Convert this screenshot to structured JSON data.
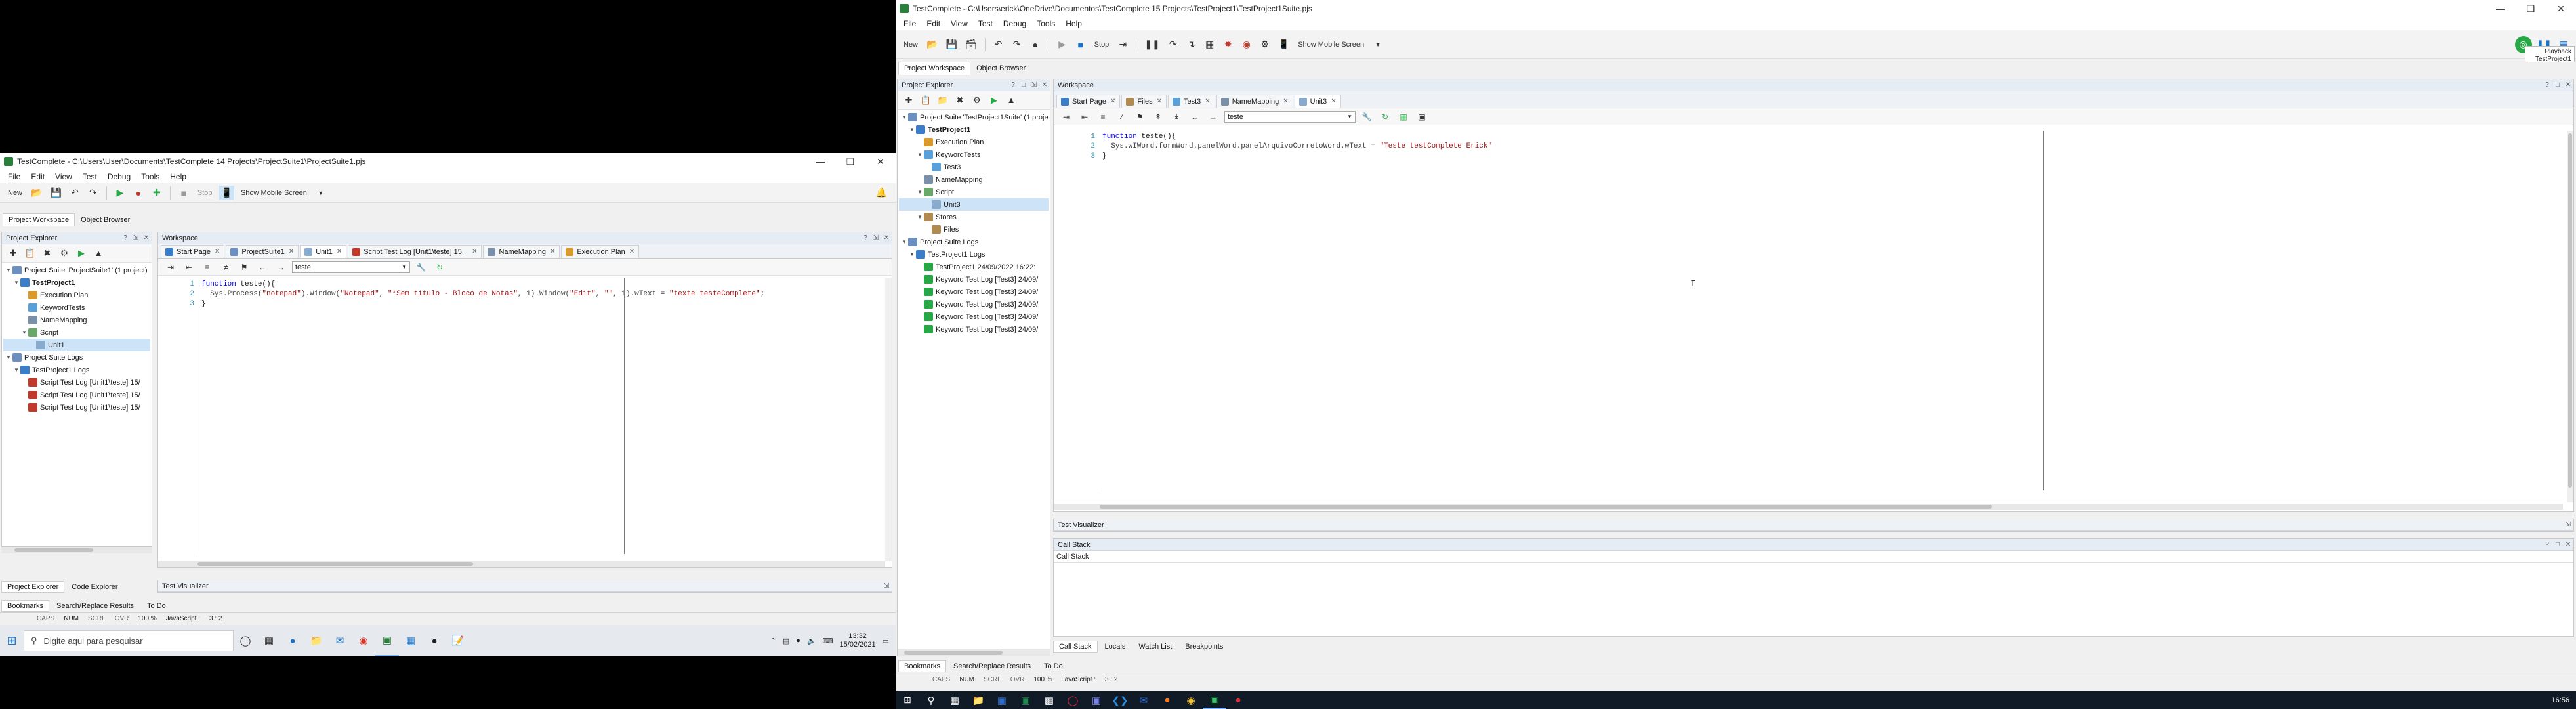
{
  "left": {
    "title": "TestComplete - C:\\Users\\User\\Documents\\TestComplete 14 Projects\\ProjectSuite1\\ProjectSuite1.pjs",
    "menu": [
      "File",
      "Edit",
      "View",
      "Test",
      "Debug",
      "Tools",
      "Help"
    ],
    "toolbar": {
      "new_label": "New",
      "stop_label": "Stop",
      "mobile_label": "Show Mobile Screen"
    },
    "project_tabs": [
      "Project Workspace",
      "Object Browser"
    ],
    "explorer_title": "Project Explorer",
    "workspace_title": "Workspace",
    "tree": [
      {
        "label": "Project Suite 'ProjectSuite1' (1 project)",
        "level": 0,
        "exp": "▼",
        "color": "#6b8fbf"
      },
      {
        "label": "TestProject1",
        "level": 1,
        "exp": "▼",
        "color": "#3a7dc9",
        "bold": true
      },
      {
        "label": "Execution Plan",
        "level": 2,
        "exp": "",
        "color": "#d99a2b"
      },
      {
        "label": "KeywordTests",
        "level": 2,
        "exp": "",
        "color": "#5aa0d8"
      },
      {
        "label": "NameMapping",
        "level": 2,
        "exp": "",
        "color": "#7a8fa8"
      },
      {
        "label": "Script",
        "level": 2,
        "exp": "▼",
        "color": "#6aa86a"
      },
      {
        "label": "Unit1",
        "level": 3,
        "exp": "",
        "color": "#88aacc",
        "selected": true
      },
      {
        "label": "Project Suite Logs",
        "level": 0,
        "exp": "▼",
        "color": "#6b8fbf"
      },
      {
        "label": "TestProject1 Logs",
        "level": 1,
        "exp": "▼",
        "color": "#3a7dc9"
      },
      {
        "label": "Script Test Log [Unit1\\teste] 15/",
        "level": 2,
        "exp": "",
        "color": "#c0392b"
      },
      {
        "label": "Script Test Log [Unit1\\teste] 15/",
        "level": 2,
        "exp": "",
        "color": "#c0392b"
      },
      {
        "label": "Script Test Log [Unit1\\teste] 15/",
        "level": 2,
        "exp": "",
        "color": "#c0392b"
      }
    ],
    "doc_tabs": [
      {
        "label": "Start Page",
        "color": "#3a7dc9"
      },
      {
        "label": "ProjectSuite1",
        "color": "#6b8fbf"
      },
      {
        "label": "Unit1",
        "color": "#88aacc",
        "active": true
      },
      {
        "label": "Script Test Log [Unit1\\teste] 15...",
        "color": "#c0392b"
      },
      {
        "label": "NameMapping",
        "color": "#7a8fa8"
      },
      {
        "label": "Execution Plan",
        "color": "#d99a2b"
      }
    ],
    "routine_select": "teste",
    "code": [
      [
        {
          "t": "function ",
          "c": "kw"
        },
        {
          "t": "teste(){",
          "c": ""
        }
      ],
      [
        {
          "t": "  Sys.Process(",
          "c": "cdim"
        },
        {
          "t": "\"notepad\"",
          "c": "str"
        },
        {
          "t": ").Window(",
          "c": "cdim"
        },
        {
          "t": "\"Notepad\"",
          "c": "str"
        },
        {
          "t": ", ",
          "c": "cdim"
        },
        {
          "t": "\"*Sem título - Bloco de Notas\"",
          "c": "str"
        },
        {
          "t": ", 1).Window(",
          "c": "cdim"
        },
        {
          "t": "\"Edit\"",
          "c": "str"
        },
        {
          "t": ", ",
          "c": "cdim"
        },
        {
          "t": "\"\"",
          "c": "str"
        },
        {
          "t": ", 1).wText = ",
          "c": "cdim"
        },
        {
          "t": "\"texte testeComplete\"",
          "c": "str"
        },
        {
          "t": ";",
          "c": "cdim"
        }
      ],
      [
        {
          "t": "}",
          "c": ""
        }
      ]
    ],
    "bottom_tabs": [
      "Project Explorer",
      "Code Explorer"
    ],
    "visualizer_title": "Test Visualizer",
    "lower_tabs": [
      "Bookmarks",
      "Search/Replace Results",
      "To Do"
    ],
    "status": {
      "caps": "CAPS",
      "num": "NUM",
      "scrl": "SCRL",
      "ovr": "OVR",
      "zoom": "100 %",
      "lang": "JavaScript :",
      "pos": "3 :   2"
    }
  },
  "left_taskbar": {
    "search_placeholder": "Digite aqui para pesquisar",
    "time": "13:32",
    "date": "15/02/2021"
  },
  "right": {
    "title": "TestComplete - C:\\Users\\erick\\OneDrive\\Documentos\\TestComplete 15 Projects\\TestProject1\\TestProject1Suite.pjs",
    "menu": [
      "File",
      "Edit",
      "View",
      "Test",
      "Debug",
      "Tools",
      "Help"
    ],
    "toolbar": {
      "new_label": "New",
      "stop_label": "Stop",
      "mobile_label": "Show Mobile Screen"
    },
    "playback_label": "Playback",
    "playback_project": "TestProject1",
    "project_tabs": [
      "Project Workspace",
      "Object Browser"
    ],
    "explorer_title": "Project Explorer",
    "workspace_title": "Workspace",
    "tree": [
      {
        "label": "Project Suite 'TestProject1Suite' (1 proje",
        "level": 0,
        "exp": "▼",
        "color": "#6b8fbf"
      },
      {
        "label": "TestProject1",
        "level": 1,
        "exp": "▼",
        "color": "#3a7dc9",
        "bold": true
      },
      {
        "label": "Execution Plan",
        "level": 2,
        "exp": "",
        "color": "#d99a2b"
      },
      {
        "label": "KeywordTests",
        "level": 2,
        "exp": "▼",
        "color": "#5aa0d8"
      },
      {
        "label": "Test3",
        "level": 3,
        "exp": "",
        "color": "#5aa0d8"
      },
      {
        "label": "NameMapping",
        "level": 2,
        "exp": "",
        "color": "#7a8fa8"
      },
      {
        "label": "Script",
        "level": 2,
        "exp": "▼",
        "color": "#6aa86a"
      },
      {
        "label": "Unit3",
        "level": 3,
        "exp": "",
        "color": "#88aacc",
        "selected": true
      },
      {
        "label": "Stores",
        "level": 2,
        "exp": "▼",
        "color": "#b08a50"
      },
      {
        "label": "Files",
        "level": 3,
        "exp": "",
        "color": "#b08a50"
      },
      {
        "label": "Project Suite Logs",
        "level": 0,
        "exp": "▼",
        "color": "#6b8fbf"
      },
      {
        "label": "TestProject1 Logs",
        "level": 1,
        "exp": "▼",
        "color": "#3a7dc9"
      },
      {
        "label": "TestProject1 24/09/2022 16:22:",
        "level": 2,
        "exp": "",
        "color": "#27a745"
      },
      {
        "label": "Keyword Test Log [Test3] 24/09/",
        "level": 2,
        "exp": "",
        "color": "#27a745"
      },
      {
        "label": "Keyword Test Log [Test3] 24/09/",
        "level": 2,
        "exp": "",
        "color": "#27a745"
      },
      {
        "label": "Keyword Test Log [Test3] 24/09/",
        "level": 2,
        "exp": "",
        "color": "#27a745"
      },
      {
        "label": "Keyword Test Log [Test3] 24/09/",
        "level": 2,
        "exp": "",
        "color": "#27a745"
      },
      {
        "label": "Keyword Test Log [Test3] 24/09/",
        "level": 2,
        "exp": "",
        "color": "#27a745"
      }
    ],
    "doc_tabs": [
      {
        "label": "Start Page",
        "color": "#3a7dc9"
      },
      {
        "label": "Files",
        "color": "#b08a50"
      },
      {
        "label": "Test3",
        "color": "#5aa0d8"
      },
      {
        "label": "NameMapping",
        "color": "#7a8fa8"
      },
      {
        "label": "Unit3",
        "color": "#88aacc",
        "active": true
      }
    ],
    "routine_select": "teste",
    "code": [
      [
        {
          "t": "function ",
          "c": "kw"
        },
        {
          "t": "teste(){",
          "c": ""
        }
      ],
      [
        {
          "t": "  Sys.wIWord.formWord.panelWord.panelArquivoCorretoWord.wText = ",
          "c": "cdim"
        },
        {
          "t": "\"Teste testComplete Erick\"",
          "c": "str"
        }
      ],
      [
        {
          "t": "}",
          "c": ""
        }
      ]
    ],
    "visualizer_title": "Test Visualizer",
    "callstack_title": "Call Stack",
    "callstack_col": "Call Stack",
    "debug_tabs": [
      "Call Stack",
      "Locals",
      "Watch List",
      "Breakpoints"
    ],
    "lower_tabs": [
      "Bookmarks",
      "Search/Replace Results",
      "To Do"
    ],
    "status": {
      "caps": "CAPS",
      "num": "NUM",
      "scrl": "SCRL",
      "ovr": "OVR",
      "zoom": "100 %",
      "lang": "JavaScript :",
      "pos": "3 :   2"
    }
  },
  "right_taskbar": {
    "time": "16:56"
  }
}
